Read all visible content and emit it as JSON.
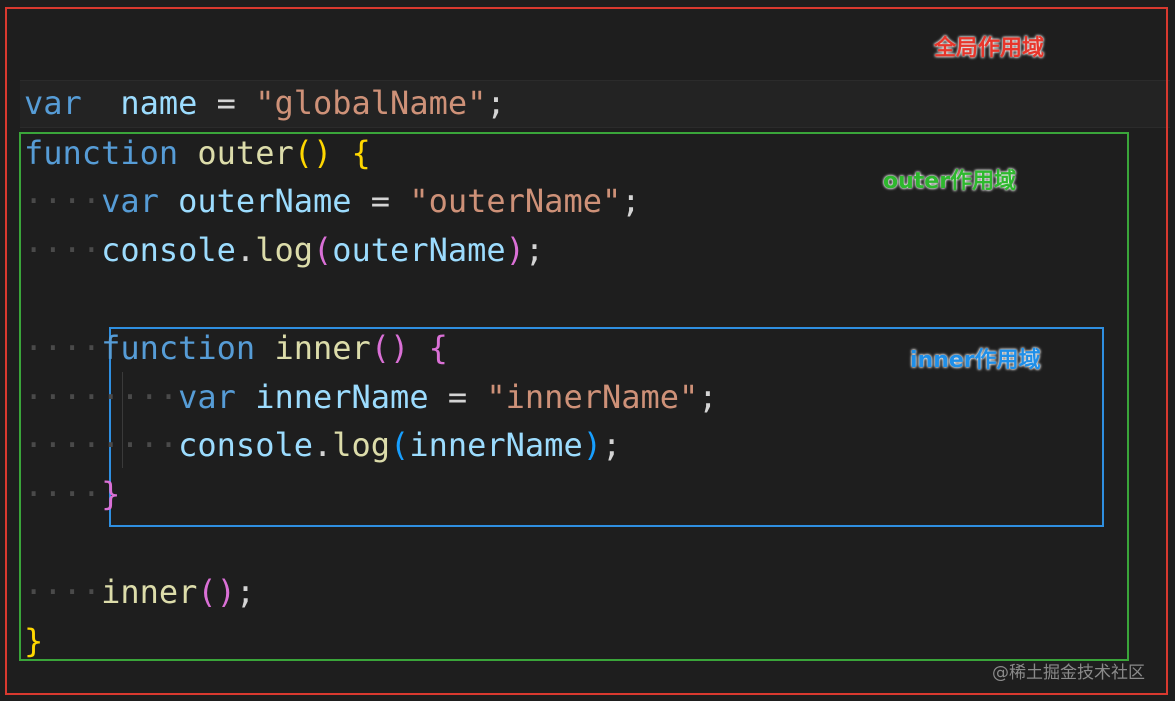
{
  "labels": {
    "global": "全局作用域",
    "outer": "outer作用域",
    "inner": "inner作用域"
  },
  "code": {
    "l1": {
      "kw": "var",
      "name": "name",
      "eq": "=",
      "str": "\"globalName\"",
      "semi": ";"
    },
    "l2": {
      "kw": "function",
      "name": "outer",
      "open": "(",
      "close": ")",
      "brace": "{"
    },
    "l3": {
      "kw": "var",
      "name": "outerName",
      "eq": "=",
      "str": "\"outerName\"",
      "semi": ";"
    },
    "l4": {
      "obj": "console",
      "dot": ".",
      "fn": "log",
      "open": "(",
      "arg": "outerName",
      "close": ")",
      "semi": ";"
    },
    "l6": {
      "kw": "function",
      "name": "inner",
      "open": "(",
      "close": ")",
      "brace": "{"
    },
    "l7": {
      "kw": "var",
      "name": "innerName",
      "eq": "=",
      "str": "\"innerName\"",
      "semi": ";"
    },
    "l8": {
      "obj": "console",
      "dot": ".",
      "fn": "log",
      "open": "(",
      "arg": "innerName",
      "close": ")",
      "semi": ";"
    },
    "l9": {
      "brace": "}"
    },
    "l11": {
      "fn": "inner",
      "open": "(",
      "close": ")",
      "semi": ";"
    },
    "l12": {
      "brace": "}"
    }
  },
  "watermark": "@稀土掘金技术社区",
  "colors": {
    "global": "#d9392f",
    "outer": "#3aa53a",
    "inner": "#2f8fe0"
  }
}
